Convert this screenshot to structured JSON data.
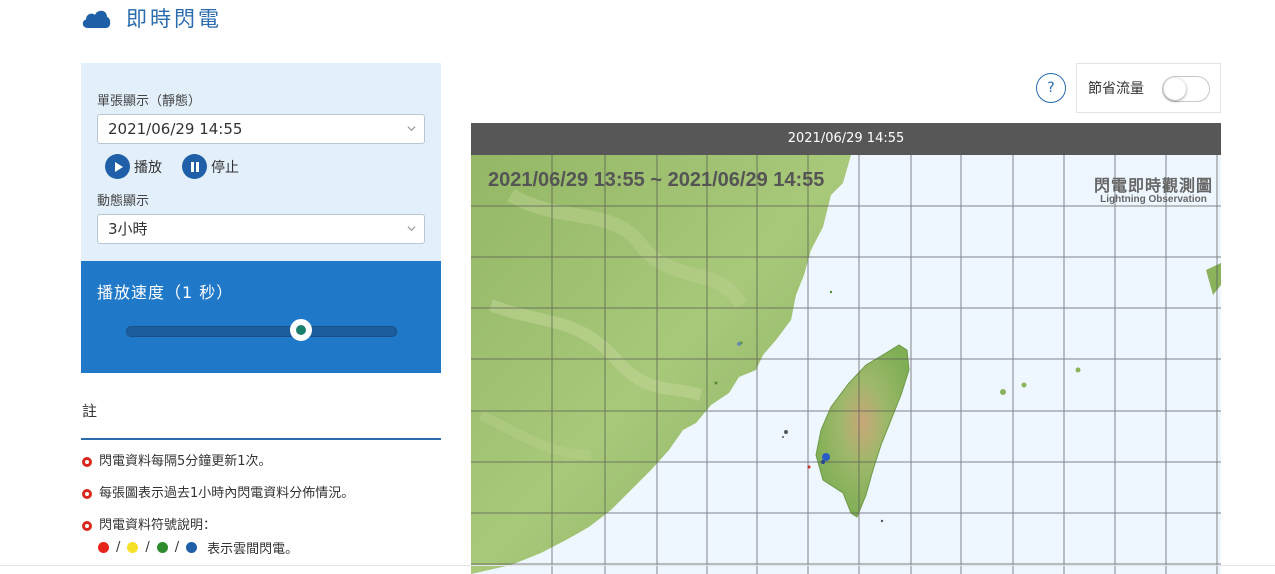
{
  "header": {
    "title": "即時閃電",
    "icon": "cloud-icon"
  },
  "controls": {
    "static_label": "單張顯示（靜態）",
    "static_value": "2021/06/29 14:55",
    "play_label": "播放",
    "stop_label": "停止",
    "dynamic_label": "動態顯示",
    "dynamic_value": "3小時",
    "speed_label": "播放速度（1 秒）",
    "speed_level": 0.65
  },
  "notes": {
    "title": "註",
    "items": [
      "閃電資料每隔5分鐘更新1次。",
      "每張圖表示過去1小時內閃電資料分佈情況。",
      "閃電資料符號說明："
    ],
    "legend_text": "表示雲間閃電。",
    "legend_separator": "/",
    "legend_colors": [
      "#e8261c",
      "#f5e02a",
      "#2e8b2e",
      "#1f5fa8"
    ]
  },
  "toolbar": {
    "help": "?",
    "save_label": "節省流量",
    "save_on": false
  },
  "map": {
    "header_time": "2021/06/29 14:55",
    "time_range": "2021/06/29 13:55 ~ 2021/06/29 14:55",
    "product_zh": "閃電即時觀測圖",
    "product_en": "Lightning Observation"
  },
  "colors": {
    "accent": "#2a6cae",
    "panel": "#1f78c8",
    "panel_light": "#e3f0fb"
  }
}
